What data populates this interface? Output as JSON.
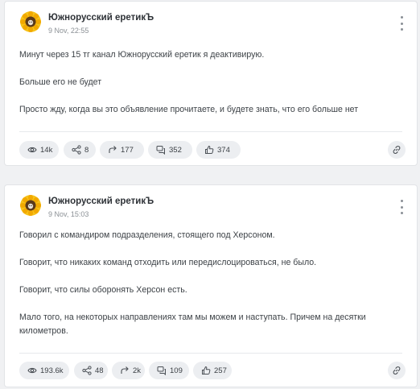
{
  "posts": [
    {
      "channel": "Южнорусский еретикЪ",
      "time": "9 Nov, 22:55",
      "paragraphs": [
        "Минут через 15 тг канал Южнорусский еретик я деактивирую.",
        "Больше его не будет",
        "Просто жду, когда вы это объявление прочитаете, и будете знать, что его больше нет"
      ],
      "stats": {
        "views": "14k",
        "shares": "8",
        "forwards": "177",
        "comments": "352",
        "likes": "374"
      }
    },
    {
      "channel": "Южнорусский еретикЪ",
      "time": "9 Nov, 15:03",
      "paragraphs": [
        "Говорил с командиром подразделения, стоящего под Херсоном.",
        "Говорит, что никаких команд отходить или передислоцироваться, не было.",
        "Говорит, что силы оборонять Херсон есть.",
        "Мало того, на некоторых направлениях там мы можем и наступать. Причем на десятки километров."
      ],
      "stats": {
        "views": "193.6k",
        "shares": "48",
        "forwards": "2k",
        "comments": "109",
        "likes": "257"
      }
    }
  ],
  "icons": {
    "avatar": "sunflower-avatar",
    "menu": "more-vertical-icon",
    "views": "eye-icon",
    "shares": "share-nodes-icon",
    "forwards": "forward-arrow-icon",
    "comments": "comments-icon",
    "likes": "thumbs-up-icon",
    "link": "link-icon"
  },
  "colors": {
    "background": "#f0f1f3",
    "card": "#ffffff",
    "pill": "#eceef1",
    "text": "#3a3f44",
    "muted": "#8b9095"
  }
}
